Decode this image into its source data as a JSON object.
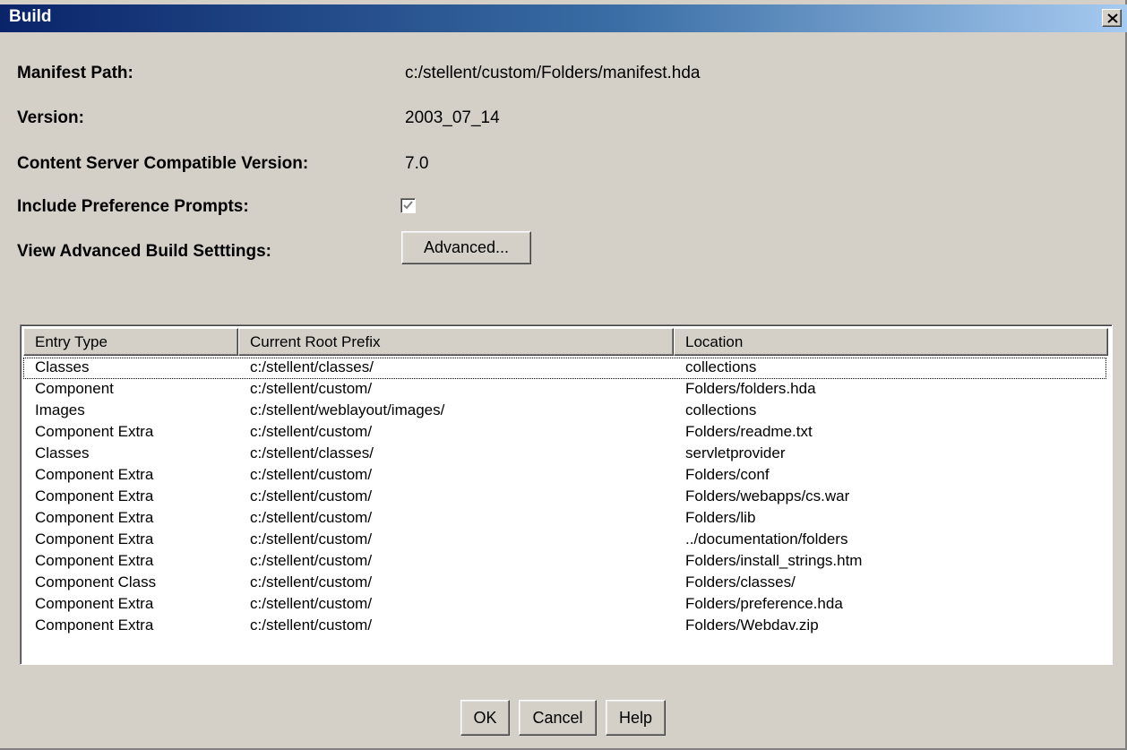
{
  "window": {
    "title": "Build"
  },
  "form": {
    "manifest_label": "Manifest Path:",
    "manifest_value": "c:/stellent/custom/Folders/manifest.hda",
    "version_label": "Version:",
    "version_value": "2003_07_14",
    "compat_label": "Content Server Compatible Version:",
    "compat_value": "7.0",
    "prompts_label": "Include Preference Prompts:",
    "prompts_checked": true,
    "advanced_label": "View Advanced Build Setttings:",
    "advanced_button": "Advanced..."
  },
  "table": {
    "columns": [
      "Entry Type",
      "Current Root Prefix",
      "Location"
    ],
    "rows": [
      [
        "Classes",
        "c:/stellent/classes/",
        "collections"
      ],
      [
        "Component",
        "c:/stellent/custom/",
        "Folders/folders.hda"
      ],
      [
        "Images",
        "c:/stellent/weblayout/images/",
        "collections"
      ],
      [
        "Component Extra",
        "c:/stellent/custom/",
        "Folders/readme.txt"
      ],
      [
        "Classes",
        "c:/stellent/classes/",
        "servletprovider"
      ],
      [
        "Component Extra",
        "c:/stellent/custom/",
        "Folders/conf"
      ],
      [
        "Component Extra",
        "c:/stellent/custom/",
        "Folders/webapps/cs.war"
      ],
      [
        "Component Extra",
        "c:/stellent/custom/",
        "Folders/lib"
      ],
      [
        "Component Extra",
        "c:/stellent/custom/",
        "../documentation/folders"
      ],
      [
        "Component Extra",
        "c:/stellent/custom/",
        "Folders/install_strings.htm"
      ],
      [
        "Component Class",
        "c:/stellent/custom/",
        "Folders/classes/"
      ],
      [
        "Component Extra",
        "c:/stellent/custom/",
        "Folders/preference.hda"
      ],
      [
        "Component Extra",
        "c:/stellent/custom/",
        "Folders/Webdav.zip"
      ]
    ],
    "selected_row": 0
  },
  "buttons": {
    "ok": "OK",
    "cancel": "Cancel",
    "help": "Help"
  },
  "icons": {
    "close": "close-icon",
    "check": "checkmark-icon"
  },
  "colors": {
    "titlebar_start": "#0a246a",
    "titlebar_end": "#a6caf0",
    "face": "#d4d0c8",
    "checkmark": "#808080"
  }
}
